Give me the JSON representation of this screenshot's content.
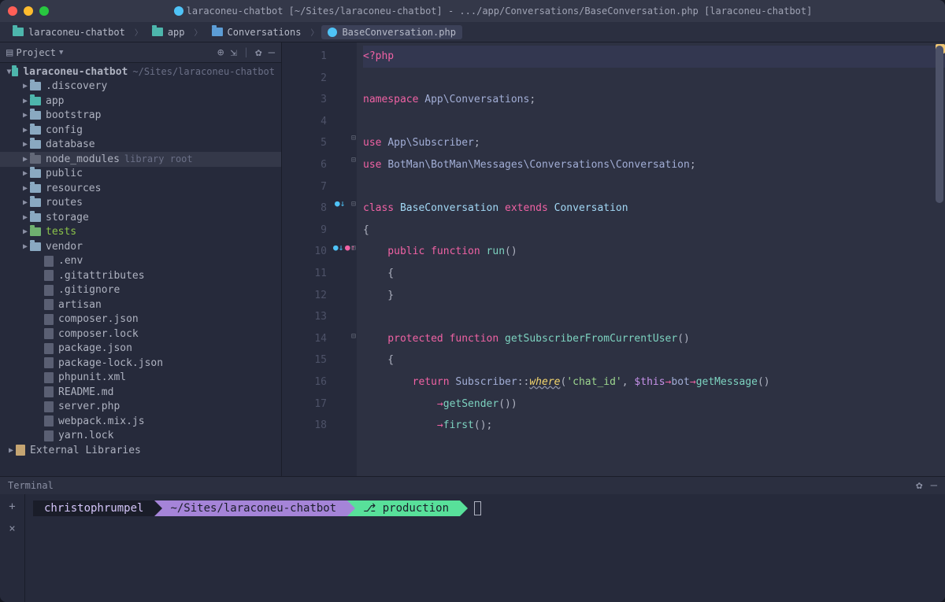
{
  "titlebar": {
    "title": "laraconeu-chatbot [~/Sites/laraconeu-chatbot] - .../app/Conversations/BaseConversation.php [laraconeu-chatbot]"
  },
  "breadcrumb": {
    "items": [
      {
        "label": "laraconeu-chatbot"
      },
      {
        "label": "app"
      },
      {
        "label": "Conversations"
      },
      {
        "label": "BaseConversation.php"
      }
    ]
  },
  "sidebar": {
    "header": "Project",
    "tree": [
      {
        "indent": 0,
        "arrow": "expanded",
        "type": "folder",
        "color": "teal",
        "label": "laraconeu-chatbot",
        "bold": true,
        "suffix": "~/Sites/laraconeu-chatbot"
      },
      {
        "indent": 1,
        "arrow": "collapsed",
        "type": "folder",
        "label": ".discovery"
      },
      {
        "indent": 1,
        "arrow": "collapsed",
        "type": "folder",
        "color": "teal",
        "label": "app"
      },
      {
        "indent": 1,
        "arrow": "collapsed",
        "type": "folder",
        "label": "bootstrap"
      },
      {
        "indent": 1,
        "arrow": "collapsed",
        "type": "folder",
        "label": "config"
      },
      {
        "indent": 1,
        "arrow": "collapsed",
        "type": "folder",
        "label": "database"
      },
      {
        "indent": 1,
        "arrow": "collapsed",
        "type": "folder",
        "color": "grey",
        "label": "node_modules",
        "suffix": "library root",
        "selected": true
      },
      {
        "indent": 1,
        "arrow": "collapsed",
        "type": "folder",
        "label": "public"
      },
      {
        "indent": 1,
        "arrow": "collapsed",
        "type": "folder",
        "label": "resources"
      },
      {
        "indent": 1,
        "arrow": "collapsed",
        "type": "folder",
        "label": "routes"
      },
      {
        "indent": 1,
        "arrow": "collapsed",
        "type": "folder",
        "label": "storage"
      },
      {
        "indent": 1,
        "arrow": "collapsed",
        "type": "folder",
        "color": "green",
        "label": "tests",
        "green": true
      },
      {
        "indent": 1,
        "arrow": "collapsed",
        "type": "folder",
        "label": "vendor"
      },
      {
        "indent": 2,
        "type": "file",
        "label": ".env"
      },
      {
        "indent": 2,
        "type": "file",
        "label": ".gitattributes"
      },
      {
        "indent": 2,
        "type": "file",
        "label": ".gitignore"
      },
      {
        "indent": 2,
        "type": "file",
        "label": "artisan"
      },
      {
        "indent": 2,
        "type": "file",
        "label": "composer.json"
      },
      {
        "indent": 2,
        "type": "file",
        "label": "composer.lock"
      },
      {
        "indent": 2,
        "type": "file",
        "label": "package.json"
      },
      {
        "indent": 2,
        "type": "file",
        "label": "package-lock.json"
      },
      {
        "indent": 2,
        "type": "file",
        "label": "phpunit.xml"
      },
      {
        "indent": 2,
        "type": "file",
        "label": "README.md"
      },
      {
        "indent": 2,
        "type": "file",
        "label": "server.php"
      },
      {
        "indent": 2,
        "type": "file",
        "label": "webpack.mix.js"
      },
      {
        "indent": 2,
        "type": "file",
        "label": "yarn.lock"
      },
      {
        "indent": 0,
        "arrow": "collapsed",
        "type": "lib",
        "label": "External Libraries"
      }
    ]
  },
  "editor": {
    "lines": [
      "1",
      "2",
      "3",
      "4",
      "5",
      "6",
      "7",
      "8",
      "9",
      "10",
      "11",
      "12",
      "13",
      "14",
      "15",
      "16",
      "17",
      "18"
    ],
    "code": {
      "l1_tag": "<?php",
      "l3_ns": "namespace ",
      "l3_ns2": "App\\Conversations",
      "l3_semi": ";",
      "l5_use": "use ",
      "l5_cls": "App\\Subscriber",
      "l5_semi": ";",
      "l6_use": "use ",
      "l6_cls": "BotMan\\BotMan\\Messages\\Conversations\\Conversation",
      "l6_semi": ";",
      "l8_cls": "class ",
      "l8_name": "BaseConversation ",
      "l8_ext": "extends ",
      "l8_base": "Conversation",
      "l9_brace": "{",
      "l10_vis": "    public ",
      "l10_fn": "function ",
      "l10_name": "run",
      "l10_paren": "()",
      "l11_brace": "    {",
      "l12_brace": "    }",
      "l14_vis": "    protected ",
      "l14_fn": "function ",
      "l14_name": "getSubscriberFromCurrentUser",
      "l14_paren": "()",
      "l15_brace": "    {",
      "l16_ret": "        return ",
      "l16_cls": "Subscriber",
      "l16_dbl": "::",
      "l16_where": "where",
      "l16_p1": "(",
      "l16_str": "'chat_id'",
      "l16_comma": ", ",
      "l16_this": "$this",
      "l16_ar1": "→",
      "l16_bot": "bot",
      "l16_ar2": "→",
      "l16_gm": "getMessage",
      "l16_p2": "()",
      "l17_ar": "            →",
      "l17_gs": "getSender",
      "l17_p": "())",
      "l18_ar": "            →",
      "l18_f": "first",
      "l18_p": "();"
    }
  },
  "terminal": {
    "header": "Terminal",
    "prompt": {
      "user": "christophrumpel",
      "path": "~/Sites/laraconeu-chatbot",
      "branch": "⎇ production"
    }
  }
}
